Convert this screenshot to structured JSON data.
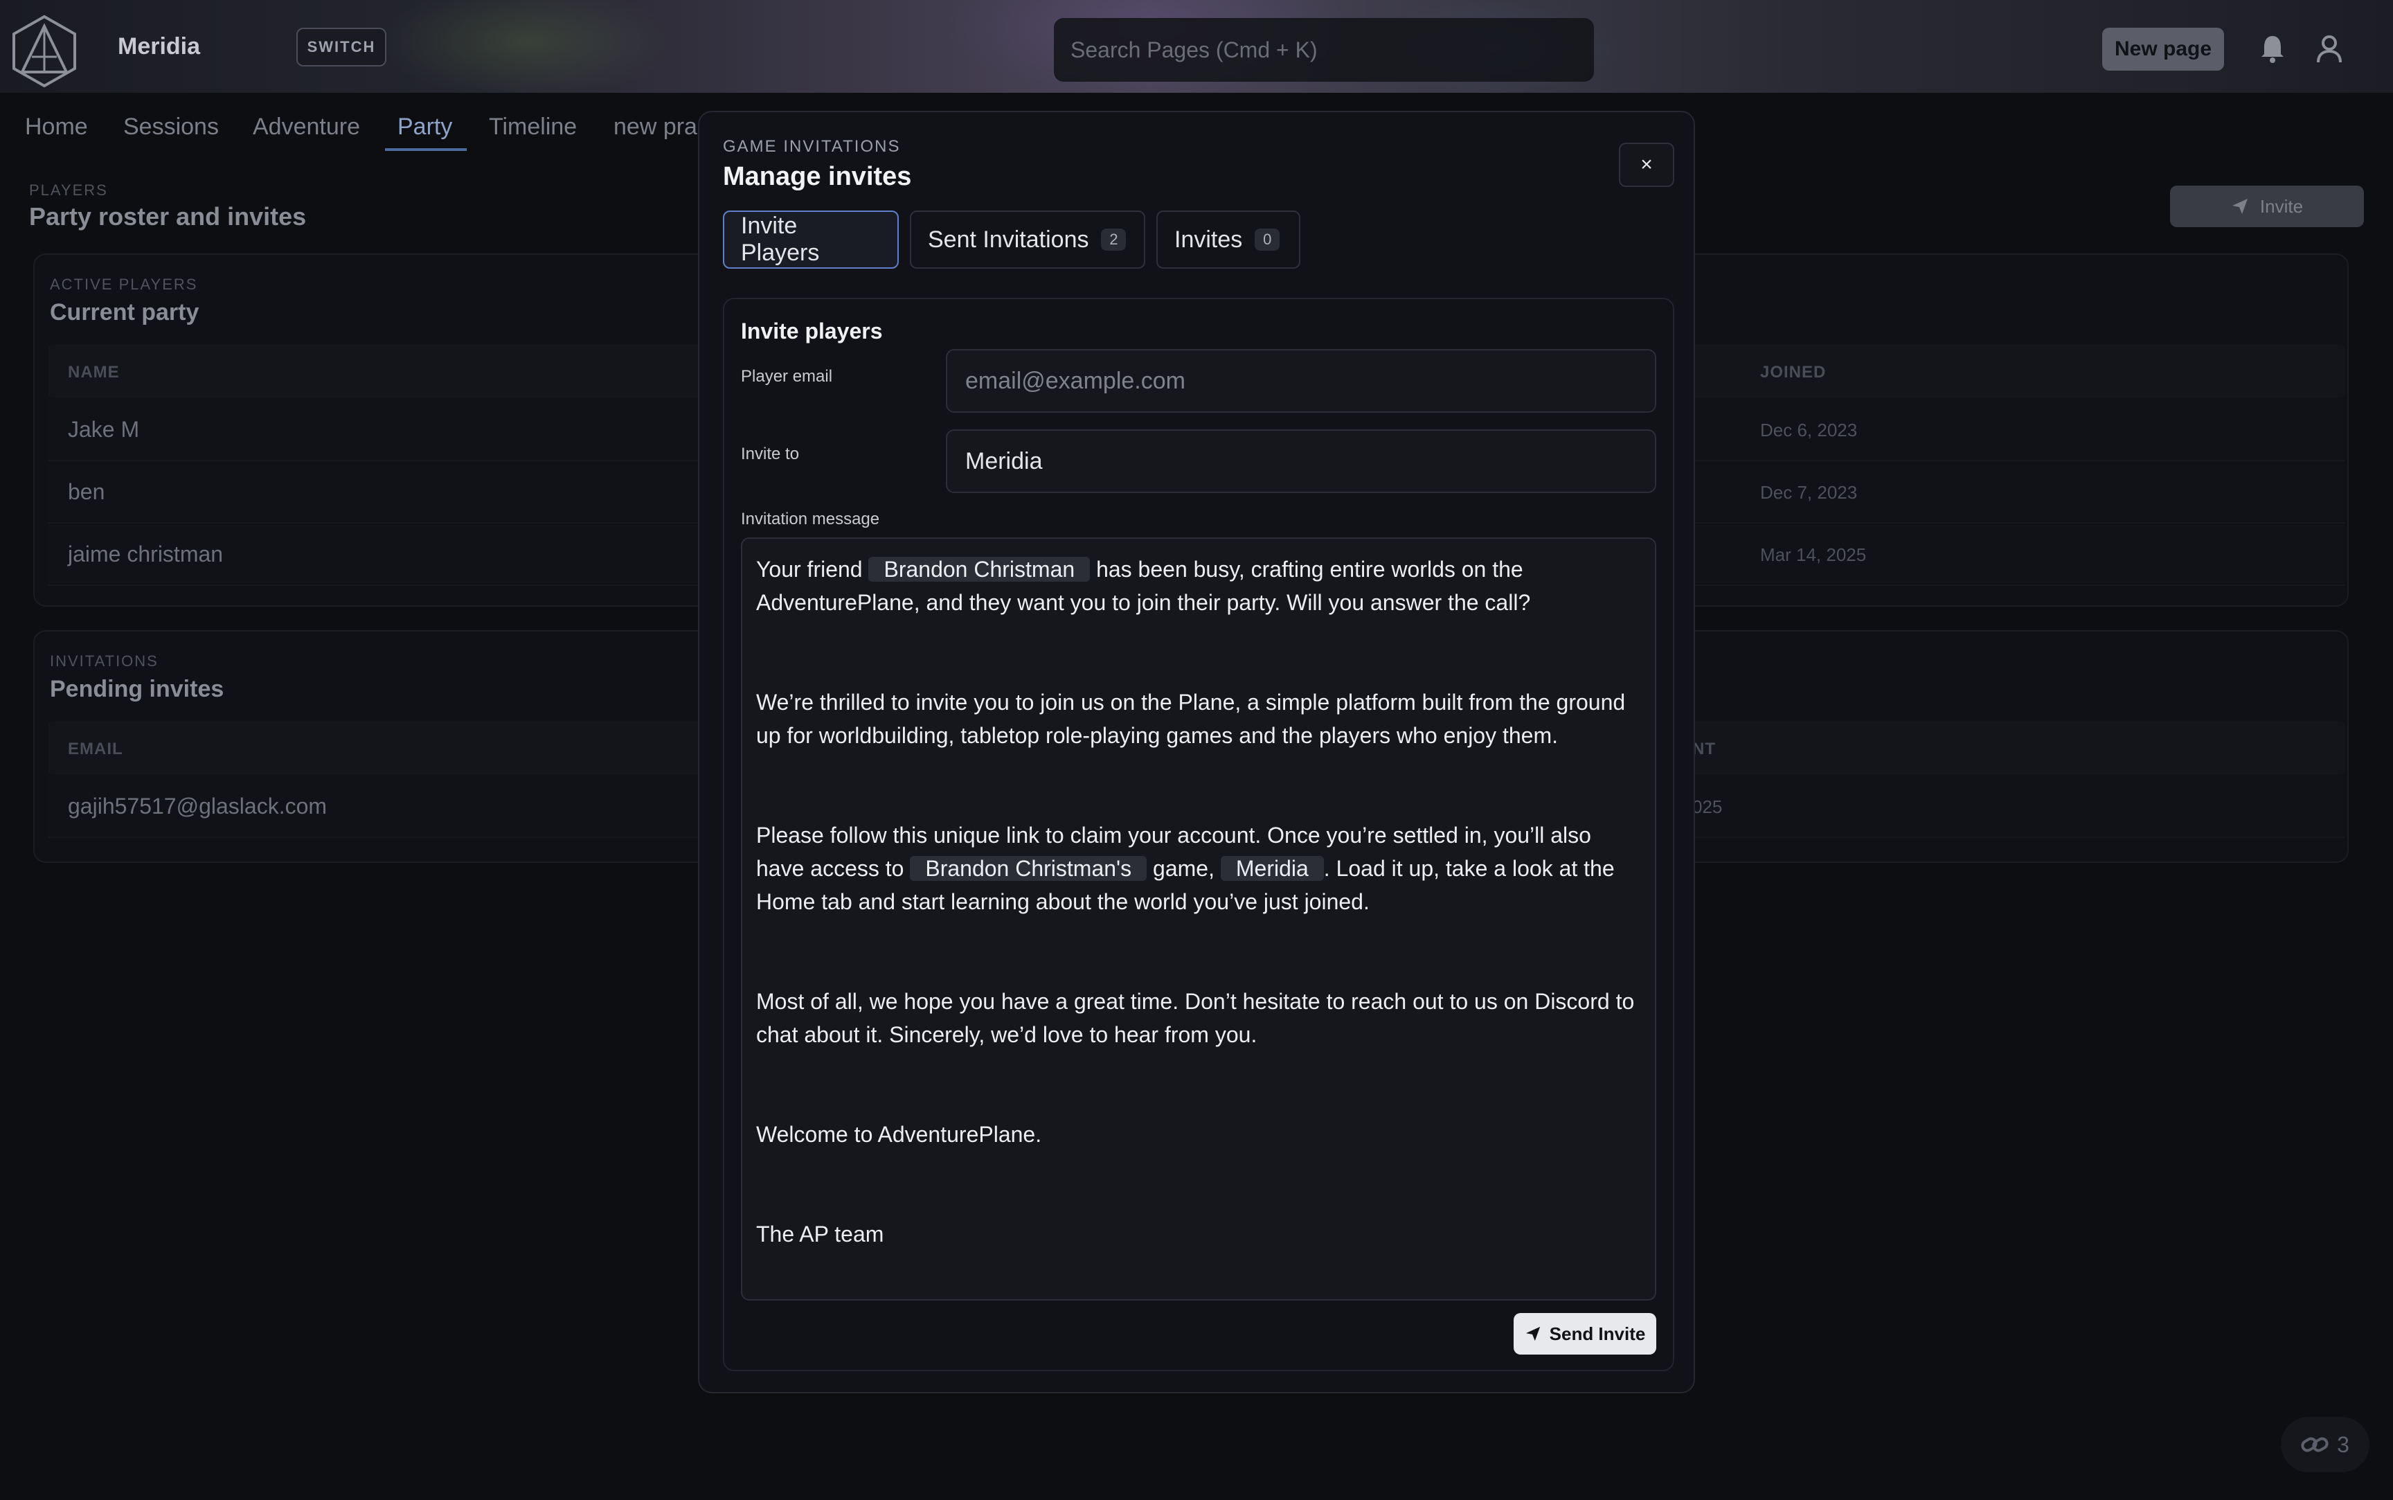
{
  "app": {
    "brand": "Meridia",
    "switch_label": "SWITCH",
    "search_placeholder": "Search Pages (Cmd + K)",
    "new_page_label": "New page"
  },
  "nav": {
    "tabs": [
      {
        "label": "Home"
      },
      {
        "label": "Sessions"
      },
      {
        "label": "Adventure"
      },
      {
        "label": "Party"
      },
      {
        "label": "Timeline"
      },
      {
        "label": "new pra"
      }
    ],
    "active": "Party"
  },
  "page": {
    "eyebrow": "PLAYERS",
    "title": "Party roster and invites",
    "invite_label": "Invite",
    "active_players": {
      "eyebrow": "ACTIVE PLAYERS",
      "title": "Current party",
      "col_name": "NAME",
      "col_joined": "JOINED",
      "rows": [
        {
          "name": "Jake M",
          "joined": "Dec 6, 2023"
        },
        {
          "name": "ben",
          "joined": "Dec 7, 2023"
        },
        {
          "name": "jaime christman",
          "joined": "Mar 14, 2025"
        }
      ]
    },
    "invitations": {
      "eyebrow": "INVITATIONS",
      "title": "Pending invites",
      "col_email": "EMAIL",
      "col_sent": "NT",
      "rows": [
        {
          "email": "gajih57517@glaslack.com",
          "sent": "025"
        }
      ]
    },
    "link_count": "3"
  },
  "modal": {
    "eyebrow": "GAME INVITATIONS",
    "title": "Manage invites",
    "close_label": "×",
    "tabs": [
      {
        "label": "Invite Players"
      },
      {
        "label": "Sent Invitations",
        "count": "2"
      },
      {
        "label": "Invites",
        "count": "0"
      }
    ],
    "panel": {
      "title": "Invite players",
      "email_label": "Player email",
      "email_placeholder": "email@example.com",
      "invite_to_label": "Invite to",
      "invite_to_value": "Meridia",
      "message_label": "Invitation message",
      "message": {
        "p1_a": "Your friend",
        "p1_chip": "Brandon Christman",
        "p1_b": "has been busy, crafting entire worlds on the AdventurePlane, and they want you to join their party. Will you answer the call?",
        "p2": "We’re thrilled to invite you to join us on the Plane, a simple platform built from the ground up for worldbuilding, tabletop role-playing games and the players who enjoy them.",
        "p3_a": "Please follow this unique link to claim your account. Once you’re settled in, you’ll also have access to",
        "p3_chip1": "Brandon Christman's",
        "p3_b": "game,",
        "p3_chip2": "Meridia",
        "p3_c": ". Load it up, take a look at the Home tab and start learning about the world you’ve just joined.",
        "p4": "Most of all, we hope you have a great time. Don’t hesitate to reach out to us on Discord to chat about it. Sincerely, we’d love to hear from you.",
        "p5": "Welcome to AdventurePlane.",
        "p6": "The AP team"
      },
      "send_label": "Send Invite"
    }
  }
}
